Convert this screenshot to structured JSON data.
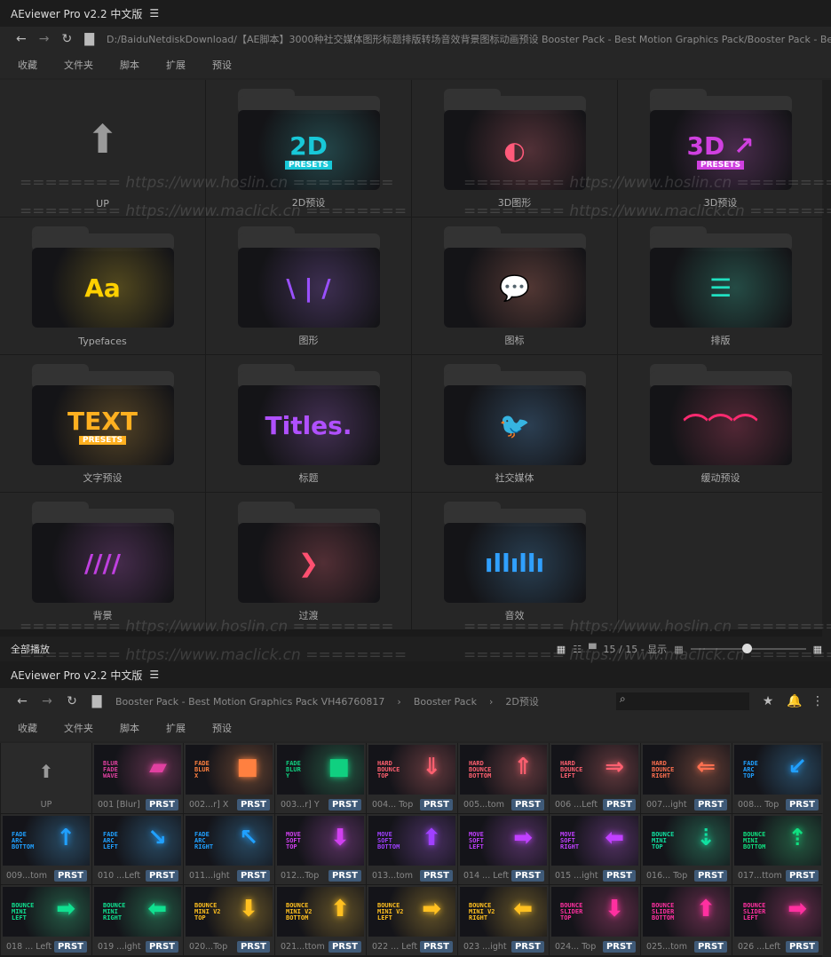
{
  "app_title": "AEviewer Pro v2.2 中文版",
  "top": {
    "path": "D:/BaiduNetdiskDownload/【AE脚本】3000种社交媒体图形标题排版转场音效背景图标动画预设 Booster Pack - Best Motion Graphics Pack/Booster Pack - Best Motion",
    "menu": [
      "收藏",
      "文件夹",
      "脚本",
      "扩展",
      "预设"
    ],
    "folders": [
      {
        "label": "UP",
        "up": true
      },
      {
        "label": "2D预设",
        "art": [
          "2D",
          "PRESETS"
        ],
        "color": "#18c8d8"
      },
      {
        "label": "3D图形",
        "art": [
          "◐"
        ],
        "color": "#ff5a7a"
      },
      {
        "label": "3D预设",
        "art": [
          "3D ↗",
          "PRESETS"
        ],
        "color": "#d040e0"
      },
      {
        "label": "Typefaces",
        "art": [
          "Aa"
        ],
        "color": "#ffd000"
      },
      {
        "label": "图形",
        "art": [
          "\\ | /"
        ],
        "color": "#9a50ff"
      },
      {
        "label": "图标",
        "art": [
          "💬"
        ],
        "color": "#ff7a6a"
      },
      {
        "label": "排版",
        "art": [
          "☰"
        ],
        "color": "#20e0c0"
      },
      {
        "label": "文字预设",
        "art": [
          "TEXT",
          "PRESETS"
        ],
        "color": "#ffb020"
      },
      {
        "label": "标题",
        "art": [
          "Titles."
        ],
        "color": "#b050ff"
      },
      {
        "label": "社交媒体",
        "art": [
          "🐦"
        ],
        "color": "#40a0ff"
      },
      {
        "label": "缓动预设",
        "art": [
          "⌒⌒⌒"
        ],
        "color": "#ff2a70"
      },
      {
        "label": "背景",
        "art": [
          "////"
        ],
        "color": "#c040e0"
      },
      {
        "label": "过渡",
        "art": [
          "❯"
        ],
        "color": "#ff5070"
      },
      {
        "label": "音效",
        "art": [
          "ıllıllı"
        ],
        "color": "#30a0ff"
      }
    ]
  },
  "status": {
    "play_all": "全部播放",
    "count": "15 / 15 - 显示",
    "zoom_fraction": 0.45
  },
  "bottom": {
    "breadcrumb": [
      "Booster Pack - Best Motion Graphics Pack VH46760817",
      "Booster Pack",
      "2D预设"
    ],
    "menu": [
      "收藏",
      "文件夹",
      "脚本",
      "扩展",
      "预设"
    ],
    "up_label": "UP",
    "badge": "PRST",
    "presets": [
      {
        "caption": "001 [Blur]",
        "lines": [
          "BLUR",
          "FADE",
          "WAVE"
        ],
        "color": "#e040a0",
        "arrow": "▰"
      },
      {
        "caption": "002...r] X",
        "lines": [
          "FADE",
          "BLUR",
          "X"
        ],
        "color": "#ff8040",
        "arrow": "■"
      },
      {
        "caption": "003...r] Y",
        "lines": [
          "FADE",
          "BLUR",
          "Y"
        ],
        "color": "#10d080",
        "arrow": "■"
      },
      {
        "caption": "004... Top",
        "lines": [
          "HARD",
          "BOUNCE",
          "TOP"
        ],
        "color": "#ff6070",
        "arrow": "⇓"
      },
      {
        "caption": "005...tom",
        "lines": [
          "HARD",
          "BOUNCE",
          "BOTTOM"
        ],
        "color": "#ff6070",
        "arrow": "⇑"
      },
      {
        "caption": "006 ...Left",
        "lines": [
          "HARD",
          "BOUNCE",
          "LEFT"
        ],
        "color": "#ff6070",
        "arrow": "⇒"
      },
      {
        "caption": "007...ight",
        "lines": [
          "HARD",
          "BOUNCE",
          "RIGHT"
        ],
        "color": "#ff7050",
        "arrow": "⇐"
      },
      {
        "caption": "008... Top",
        "lines": [
          "FADE",
          "ARC",
          "TOP"
        ],
        "color": "#20a0ff",
        "arrow": "↙"
      },
      {
        "caption": "009...tom",
        "lines": [
          "FADE",
          "ARC",
          "BOTTOM"
        ],
        "color": "#20a0ff",
        "arrow": "↑"
      },
      {
        "caption": "010 ...Left",
        "lines": [
          "FADE",
          "ARC",
          "LEFT"
        ],
        "color": "#20a0ff",
        "arrow": "↘"
      },
      {
        "caption": "011...ight",
        "lines": [
          "FADE",
          "ARC",
          "RIGHT"
        ],
        "color": "#20a0ff",
        "arrow": "↖"
      },
      {
        "caption": "012...Top",
        "lines": [
          "MOVE",
          "SOFT",
          "TOP"
        ],
        "color": "#d040f0",
        "arrow": "⬇"
      },
      {
        "caption": "013...tom",
        "lines": [
          "MOVE",
          "SOFT",
          "BOTTOM"
        ],
        "color": "#a040ff",
        "arrow": "⬆"
      },
      {
        "caption": "014 ... Left",
        "lines": [
          "MOVE",
          "SOFT",
          "LEFT"
        ],
        "color": "#c040ff",
        "arrow": "➡"
      },
      {
        "caption": "015 ...ight",
        "lines": [
          "MOVE",
          "SOFT",
          "RIGHT"
        ],
        "color": "#c040ff",
        "arrow": "⬅"
      },
      {
        "caption": "016... Top",
        "lines": [
          "BOUNCE",
          "MINI",
          "TOP"
        ],
        "color": "#10e0a0",
        "arrow": "⇣"
      },
      {
        "caption": "017...ttom",
        "lines": [
          "BOUNCE",
          "MINI",
          "BOTTOM"
        ],
        "color": "#10e080",
        "arrow": "⇡"
      },
      {
        "caption": "018 ... Left",
        "lines": [
          "BOUNCE",
          "MINI",
          "LEFT"
        ],
        "color": "#10e090",
        "arrow": "➡"
      },
      {
        "caption": "019 ...ight",
        "lines": [
          "BOUNCE",
          "MINI",
          "RIGHT"
        ],
        "color": "#10e090",
        "arrow": "⬅"
      },
      {
        "caption": "020...Top",
        "lines": [
          "BOUNCE",
          "MINI V2",
          "TOP"
        ],
        "color": "#ffc020",
        "arrow": "⬇"
      },
      {
        "caption": "021...ttom",
        "lines": [
          "BOUNCE",
          "MINI V2",
          "BOTTOM"
        ],
        "color": "#ffc020",
        "arrow": "⬆"
      },
      {
        "caption": "022 ... Left",
        "lines": [
          "BOUNCE",
          "MINI V2",
          "LEFT"
        ],
        "color": "#ffc020",
        "arrow": "➡"
      },
      {
        "caption": "023 ...ight",
        "lines": [
          "BOUNCE",
          "MINI V2",
          "RIGHT"
        ],
        "color": "#ffc020",
        "arrow": "⬅"
      },
      {
        "caption": "024... Top",
        "lines": [
          "BOUNCE",
          "SLIDER",
          "TOP"
        ],
        "color": "#ff30a0",
        "arrow": "⬇"
      },
      {
        "caption": "025...tom",
        "lines": [
          "BOUNCE",
          "SLIDER",
          "BOTTOM"
        ],
        "color": "#ff30a0",
        "arrow": "⬆"
      },
      {
        "caption": "026 ...Left",
        "lines": [
          "BOUNCE",
          "SLIDER",
          "LEFT"
        ],
        "color": "#ff30a0",
        "arrow": "➡"
      }
    ]
  },
  "watermarks": [
    "======== https://www.hoslin.cn ========",
    "======== https://www.maclick.cn ========"
  ]
}
